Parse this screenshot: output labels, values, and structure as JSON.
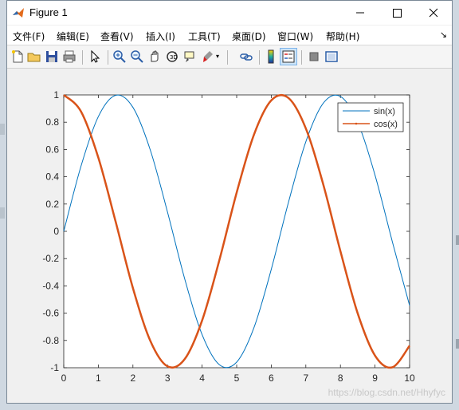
{
  "window": {
    "title": "Figure 1"
  },
  "menu": [
    {
      "label": "文件(F)"
    },
    {
      "label": "编辑(E)"
    },
    {
      "label": "查看(V)"
    },
    {
      "label": "插入(I)"
    },
    {
      "label": "工具(T)"
    },
    {
      "label": "桌面(D)"
    },
    {
      "label": "窗口(W)"
    },
    {
      "label": "帮助(H)"
    }
  ],
  "toolbar": {
    "icons": [
      "new-figure-icon",
      "open-file-icon",
      "save-icon",
      "print-icon",
      "pointer-icon",
      "zoom-in-icon",
      "zoom-out-icon",
      "pan-icon",
      "rotate-3d-icon",
      "data-cursor-icon",
      "brush-icon",
      "link-icon",
      "colorbar-icon",
      "legend-icon",
      "hide-plot-tools-icon",
      "show-plot-tools-icon"
    ],
    "active": "legend-icon"
  },
  "watermark": "https://blog.csdn.net/Hhyfyc",
  "chart_data": {
    "type": "line",
    "xlim": [
      0,
      10
    ],
    "ylim": [
      -1,
      1
    ],
    "xticks": [
      "0",
      "1",
      "2",
      "3",
      "4",
      "5",
      "6",
      "7",
      "8",
      "9",
      "10"
    ],
    "yticks": [
      "1",
      "0.8",
      "0.6",
      "0.4",
      "0.2",
      "0",
      "-0.2",
      "-0.4",
      "-0.6",
      "-0.8",
      "-1"
    ],
    "legend_position": "top-right",
    "grid": false,
    "series": [
      {
        "name": "sin(x)",
        "color": "#0072bd",
        "width": 1,
        "x": [
          0,
          0.5,
          1,
          1.5,
          2,
          2.5,
          3,
          3.5,
          4,
          4.5,
          5,
          5.5,
          6,
          6.5,
          7,
          7.5,
          8,
          8.5,
          9,
          9.5,
          10
        ],
        "y": [
          0,
          0.479,
          0.841,
          0.997,
          0.909,
          0.598,
          0.141,
          -0.351,
          -0.757,
          -0.978,
          -0.959,
          -0.706,
          -0.279,
          0.215,
          0.657,
          0.938,
          0.989,
          0.798,
          0.412,
          -0.075,
          -0.544
        ]
      },
      {
        "name": "cos(x)",
        "color": "#d95319",
        "width": 2.5,
        "x": [
          0,
          0.5,
          1,
          1.5,
          2,
          2.5,
          3,
          3.5,
          4,
          4.5,
          5,
          5.5,
          6,
          6.5,
          7,
          7.5,
          8,
          8.5,
          9,
          9.5,
          10
        ],
        "y": [
          1,
          0.878,
          0.54,
          0.071,
          -0.416,
          -0.801,
          -0.99,
          -0.936,
          -0.654,
          -0.211,
          0.284,
          0.709,
          0.96,
          0.977,
          0.754,
          0.347,
          -0.146,
          -0.602,
          -0.911,
          -0.997,
          -0.839
        ]
      }
    ]
  }
}
